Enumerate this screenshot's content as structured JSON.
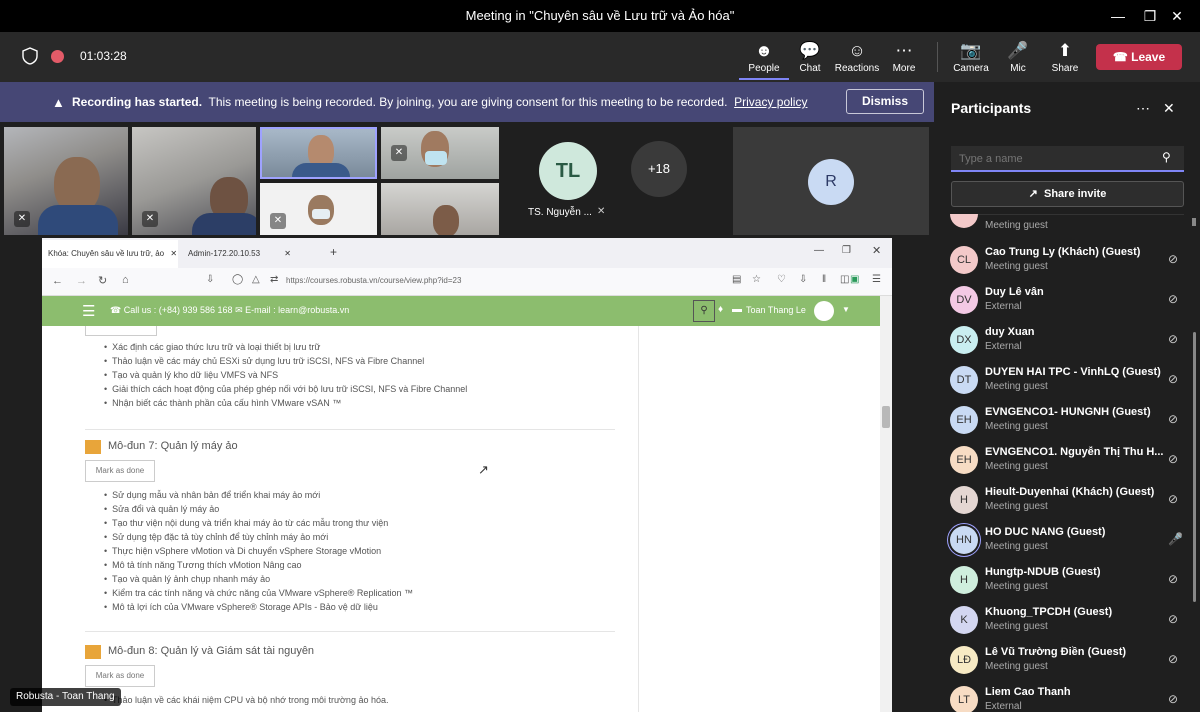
{
  "window": {
    "title": "Meeting in \"Chuyên sâu về Lưu trữ và Ảo hóa\""
  },
  "topbar": {
    "timer": "01:03:28",
    "people": "People",
    "chat": "Chat",
    "reactions": "Reactions",
    "more": "More",
    "camera": "Camera",
    "mic": "Mic",
    "share": "Share",
    "leave": "Leave"
  },
  "banner": {
    "title": "Recording has started.",
    "text": "This meeting is being recorded. By joining, you are giving consent for this meeting to be recorded.",
    "link": "Privacy policy",
    "dismiss": "Dismiss"
  },
  "videos": {
    "tl_initials": "TL",
    "tl_name": "TS. Nguyễn ...",
    "overflow": "+18",
    "r_initials": "R",
    "presenter_label": "Robusta - Toan Thang"
  },
  "browser": {
    "tab1": "Khóa: Chuyên sâu về lưu trữ, ảo",
    "tab2": "Admin-172.20.10.53",
    "url": "https://courses.robusta.vn/course/view.php?id=23",
    "contact": "Call us : (+84) 939 586 168",
    "email": "E-mail : learn@robusta.vn",
    "user": "Toan Thang Le",
    "items_a": [
      "Xác định các giao thức lưu trữ và loại thiết bị lưu trữ",
      "Thảo luận về các máy chủ ESXi sử dụng lưu trữ iSCSI, NFS và Fibre Channel",
      "Tạo và quản lý kho dữ liệu VMFS và NFS",
      "Giải thích cách hoạt động của phép ghép nối với bộ lưu trữ iSCSI, NFS và Fibre Channel",
      "Nhận biết các thành phần của cấu hình VMware vSAN ™"
    ],
    "module7": "Mô-đun 7: Quản lý máy ảo",
    "mark": "Mark as done",
    "items_b": [
      "Sử dụng mẫu và nhân bản để triển khai máy ảo mới",
      "Sửa đổi và quản lý máy ảo",
      "Tạo thư viện nội dung và triển khai máy ảo từ các mẫu trong thư viện",
      "Sử dụng tệp đặc tả tùy chỉnh để tùy chỉnh máy ảo mới",
      "Thực hiện vSphere vMotion và Di chuyển vSphere Storage vMotion",
      "Mô tả tính năng Tương thích vMotion Nâng cao",
      "Tạo và quản lý ảnh chụp nhanh máy ảo",
      "Kiểm tra các tính năng và chức năng của VMware vSphere® Replication ™",
      "Mô tả lợi ích của VMware vSphere® Storage APIs - Bảo vệ dữ liệu"
    ],
    "module8": "Mô-đun 8: Quản lý và Giám sát tài nguyên",
    "item_c": "Thảo luận về các khái niệm CPU và bộ nhớ trong môi trường ảo hóa."
  },
  "panel": {
    "title": "Participants",
    "search_placeholder": "Type a name",
    "share_invite": "Share invite",
    "top_sub": "Meeting guest",
    "participants": [
      {
        "initials": "CL",
        "name": "Cao Trung Ly (Khách) (Guest)",
        "sub": "Meeting guest",
        "color": "#f3c9c9"
      },
      {
        "initials": "DV",
        "name": "Duy Lê vân",
        "sub": "External",
        "color": "#f3c9e4"
      },
      {
        "initials": "DX",
        "name": "duy Xuan",
        "sub": "External",
        "color": "#c9eef0"
      },
      {
        "initials": "DT",
        "name": "DUYEN HAI TPC - VinhLQ (Guest)",
        "sub": "Meeting guest",
        "color": "#c9daf3"
      },
      {
        "initials": "EH",
        "name": "EVNGENCO1- HUNGNH (Guest)",
        "sub": "Meeting guest",
        "color": "#c9daf3"
      },
      {
        "initials": "EH",
        "name": "EVNGENCO1. Nguyễn Thị Thu H...",
        "sub": "Meeting guest",
        "color": "#f7dcc4"
      },
      {
        "initials": "H",
        "name": "Hieult-Duyenhai (Khách) (Guest)",
        "sub": "Meeting guest",
        "color": "#e4d6d2"
      },
      {
        "initials": "HN",
        "name": "HO DUC NANG (Guest)",
        "sub": "Meeting guest",
        "color": "#c9daf3"
      },
      {
        "initials": "H",
        "name": "Hungtp-NDUB (Guest)",
        "sub": "Meeting guest",
        "color": "#cfeedd"
      },
      {
        "initials": "K",
        "name": "Khuong_TPCDH (Guest)",
        "sub": "Meeting guest",
        "color": "#d3d6f0"
      },
      {
        "initials": "LĐ",
        "name": "Lê Vũ Trường Điền (Guest)",
        "sub": "Meeting guest",
        "color": "#f7eac4"
      },
      {
        "initials": "LT",
        "name": "Liem Cao Thanh",
        "sub": "External",
        "color": "#f7dcc4"
      }
    ]
  }
}
